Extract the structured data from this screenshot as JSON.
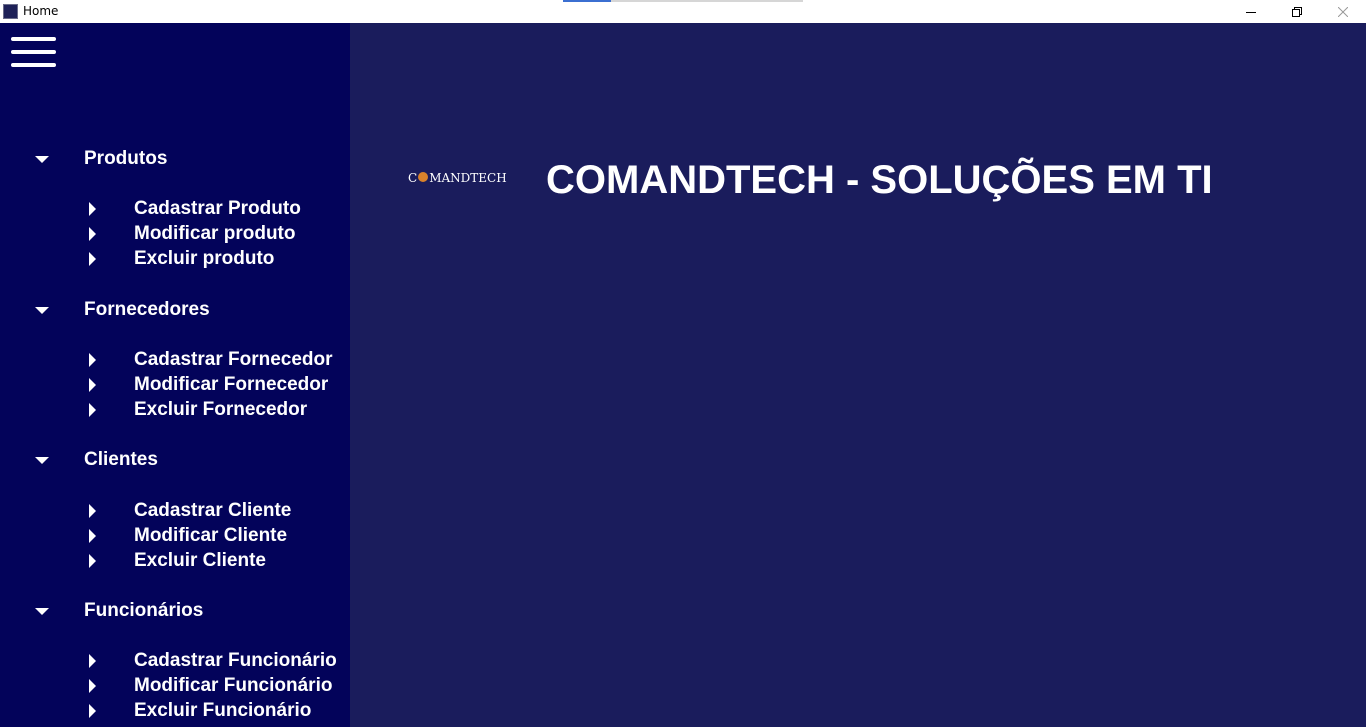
{
  "window": {
    "title": "Home",
    "controls": {
      "minimize_icon": "minimize-icon",
      "maximize_icon": "restore-icon",
      "close_icon": "close-icon"
    }
  },
  "colors": {
    "sidebar_bg": "#03035a",
    "main_bg": "#1a1c5c",
    "text": "#ffffff",
    "logo_accent": "#d9822b"
  },
  "sidebar": {
    "menu_icon": "hamburger-menu-icon",
    "groups": [
      {
        "label": "Produtos",
        "items": [
          {
            "label": "Cadastrar Produto"
          },
          {
            "label": "Modificar produto"
          },
          {
            "label": "Excluir produto"
          }
        ]
      },
      {
        "label": "Fornecedores",
        "items": [
          {
            "label": "Cadastrar Fornecedor"
          },
          {
            "label": "Modificar Fornecedor"
          },
          {
            "label": "Excluir Fornecedor"
          }
        ]
      },
      {
        "label": "Clientes",
        "items": [
          {
            "label": "Cadastrar Cliente"
          },
          {
            "label": "Modificar Cliente"
          },
          {
            "label": "Excluir Cliente"
          }
        ]
      },
      {
        "label": "Funcionários",
        "items": [
          {
            "label": "Cadastrar Funcionário"
          },
          {
            "label": "Modificar Funcionário"
          },
          {
            "label": "Excluir Funcionário"
          }
        ]
      }
    ]
  },
  "main": {
    "logo": {
      "prefix": "C",
      "suffix": "MANDTECH"
    },
    "headline": "COMANDTECH - SOLUÇÕES EM TI"
  }
}
